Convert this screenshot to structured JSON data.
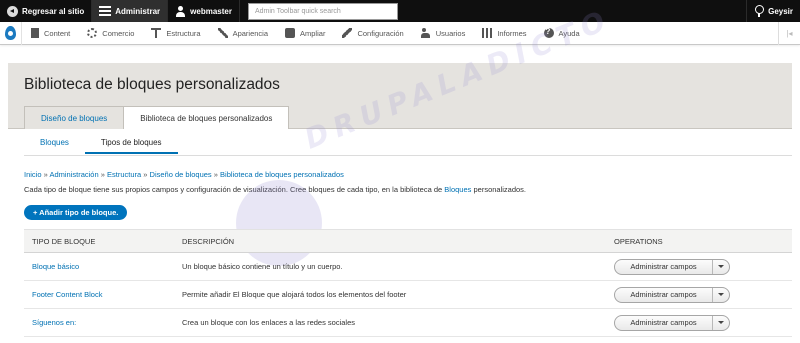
{
  "toolbar": {
    "back_label": "Regresar al sitio",
    "manage_label": "Administrar",
    "user_label": "webmaster",
    "search_placeholder": "Admin Toolbar quick search",
    "right_label": "Geysir"
  },
  "admin_menu": [
    {
      "label": "Content",
      "icon": "content-icon"
    },
    {
      "label": "Comercio",
      "icon": "commerce-icon"
    },
    {
      "label": "Estructura",
      "icon": "structure-icon"
    },
    {
      "label": "Apariencia",
      "icon": "appearance-icon"
    },
    {
      "label": "Ampliar",
      "icon": "extend-icon"
    },
    {
      "label": "Configuración",
      "icon": "configuration-icon"
    },
    {
      "label": "Usuarios",
      "icon": "users-icon"
    },
    {
      "label": "Informes",
      "icon": "reports-icon"
    },
    {
      "label": "Ayuda",
      "icon": "help-icon"
    }
  ],
  "page": {
    "title": "Biblioteca de bloques personalizados",
    "tabs": [
      "Diseño de bloques",
      "Biblioteca de bloques personalizados"
    ],
    "subtabs": [
      "Bloques",
      "Tipos de bloques"
    ],
    "breadcrumb": [
      "Inicio",
      "Administración",
      "Estructura",
      "Diseño de bloques",
      "Biblioteca de bloques personalizados"
    ],
    "description_pre": "Cada tipo de bloque tiene sus propios campos y configuración de visualización. Cree bloques de cada tipo, en la biblioteca de ",
    "description_link": "Bloques",
    "description_post": " personalizados.",
    "add_button": "+ Añadir tipo de bloque."
  },
  "table": {
    "headers": [
      "Tipo de bloque",
      "Descripción",
      "Operations"
    ],
    "rows": [
      {
        "type": "Bloque básico",
        "description": "Un bloque básico contiene un título y un cuerpo.",
        "operation": "Administrar campos"
      },
      {
        "type": "Footer Content Block",
        "description": "Permite añadir El Bloque que alojará todos los elementos del footer",
        "operation": "Administrar campos"
      },
      {
        "type": "Síguenos en:",
        "description": "Crea un bloque con los enlaces a las redes sociales",
        "operation": "Administrar campos"
      }
    ]
  },
  "watermark": "DRUPALADICTO",
  "colors": {
    "link": "#0071b3",
    "button": "#0074bd",
    "toolbar": "#0f0f0f",
    "header": "#e5e3df"
  }
}
